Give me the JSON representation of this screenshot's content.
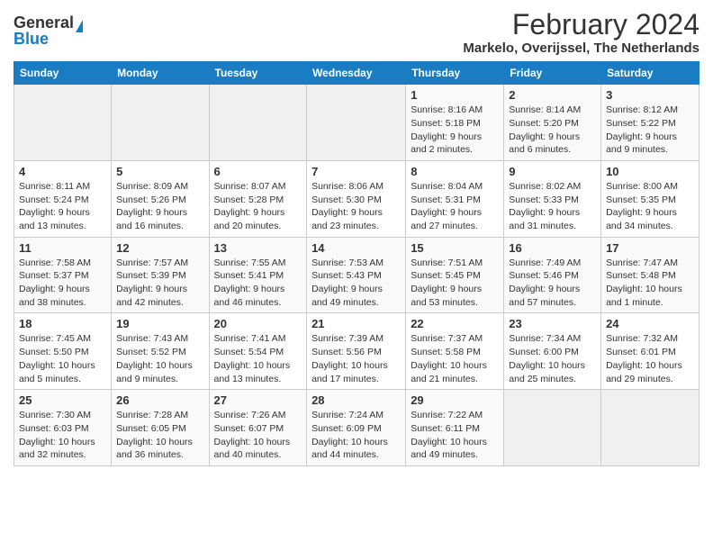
{
  "logo": {
    "general": "General",
    "blue": "Blue"
  },
  "title": "February 2024",
  "subtitle": "Markelo, Overijssel, The Netherlands",
  "headers": [
    "Sunday",
    "Monday",
    "Tuesday",
    "Wednesday",
    "Thursday",
    "Friday",
    "Saturday"
  ],
  "weeks": [
    [
      {
        "day": "",
        "info": ""
      },
      {
        "day": "",
        "info": ""
      },
      {
        "day": "",
        "info": ""
      },
      {
        "day": "",
        "info": ""
      },
      {
        "day": "1",
        "info": "Sunrise: 8:16 AM\nSunset: 5:18 PM\nDaylight: 9 hours\nand 2 minutes."
      },
      {
        "day": "2",
        "info": "Sunrise: 8:14 AM\nSunset: 5:20 PM\nDaylight: 9 hours\nand 6 minutes."
      },
      {
        "day": "3",
        "info": "Sunrise: 8:12 AM\nSunset: 5:22 PM\nDaylight: 9 hours\nand 9 minutes."
      }
    ],
    [
      {
        "day": "4",
        "info": "Sunrise: 8:11 AM\nSunset: 5:24 PM\nDaylight: 9 hours\nand 13 minutes."
      },
      {
        "day": "5",
        "info": "Sunrise: 8:09 AM\nSunset: 5:26 PM\nDaylight: 9 hours\nand 16 minutes."
      },
      {
        "day": "6",
        "info": "Sunrise: 8:07 AM\nSunset: 5:28 PM\nDaylight: 9 hours\nand 20 minutes."
      },
      {
        "day": "7",
        "info": "Sunrise: 8:06 AM\nSunset: 5:30 PM\nDaylight: 9 hours\nand 23 minutes."
      },
      {
        "day": "8",
        "info": "Sunrise: 8:04 AM\nSunset: 5:31 PM\nDaylight: 9 hours\nand 27 minutes."
      },
      {
        "day": "9",
        "info": "Sunrise: 8:02 AM\nSunset: 5:33 PM\nDaylight: 9 hours\nand 31 minutes."
      },
      {
        "day": "10",
        "info": "Sunrise: 8:00 AM\nSunset: 5:35 PM\nDaylight: 9 hours\nand 34 minutes."
      }
    ],
    [
      {
        "day": "11",
        "info": "Sunrise: 7:58 AM\nSunset: 5:37 PM\nDaylight: 9 hours\nand 38 minutes."
      },
      {
        "day": "12",
        "info": "Sunrise: 7:57 AM\nSunset: 5:39 PM\nDaylight: 9 hours\nand 42 minutes."
      },
      {
        "day": "13",
        "info": "Sunrise: 7:55 AM\nSunset: 5:41 PM\nDaylight: 9 hours\nand 46 minutes."
      },
      {
        "day": "14",
        "info": "Sunrise: 7:53 AM\nSunset: 5:43 PM\nDaylight: 9 hours\nand 49 minutes."
      },
      {
        "day": "15",
        "info": "Sunrise: 7:51 AM\nSunset: 5:45 PM\nDaylight: 9 hours\nand 53 minutes."
      },
      {
        "day": "16",
        "info": "Sunrise: 7:49 AM\nSunset: 5:46 PM\nDaylight: 9 hours\nand 57 minutes."
      },
      {
        "day": "17",
        "info": "Sunrise: 7:47 AM\nSunset: 5:48 PM\nDaylight: 10 hours\nand 1 minute."
      }
    ],
    [
      {
        "day": "18",
        "info": "Sunrise: 7:45 AM\nSunset: 5:50 PM\nDaylight: 10 hours\nand 5 minutes."
      },
      {
        "day": "19",
        "info": "Sunrise: 7:43 AM\nSunset: 5:52 PM\nDaylight: 10 hours\nand 9 minutes."
      },
      {
        "day": "20",
        "info": "Sunrise: 7:41 AM\nSunset: 5:54 PM\nDaylight: 10 hours\nand 13 minutes."
      },
      {
        "day": "21",
        "info": "Sunrise: 7:39 AM\nSunset: 5:56 PM\nDaylight: 10 hours\nand 17 minutes."
      },
      {
        "day": "22",
        "info": "Sunrise: 7:37 AM\nSunset: 5:58 PM\nDaylight: 10 hours\nand 21 minutes."
      },
      {
        "day": "23",
        "info": "Sunrise: 7:34 AM\nSunset: 6:00 PM\nDaylight: 10 hours\nand 25 minutes."
      },
      {
        "day": "24",
        "info": "Sunrise: 7:32 AM\nSunset: 6:01 PM\nDaylight: 10 hours\nand 29 minutes."
      }
    ],
    [
      {
        "day": "25",
        "info": "Sunrise: 7:30 AM\nSunset: 6:03 PM\nDaylight: 10 hours\nand 32 minutes."
      },
      {
        "day": "26",
        "info": "Sunrise: 7:28 AM\nSunset: 6:05 PM\nDaylight: 10 hours\nand 36 minutes."
      },
      {
        "day": "27",
        "info": "Sunrise: 7:26 AM\nSunset: 6:07 PM\nDaylight: 10 hours\nand 40 minutes."
      },
      {
        "day": "28",
        "info": "Sunrise: 7:24 AM\nSunset: 6:09 PM\nDaylight: 10 hours\nand 44 minutes."
      },
      {
        "day": "29",
        "info": "Sunrise: 7:22 AM\nSunset: 6:11 PM\nDaylight: 10 hours\nand 49 minutes."
      },
      {
        "day": "",
        "info": ""
      },
      {
        "day": "",
        "info": ""
      }
    ]
  ]
}
